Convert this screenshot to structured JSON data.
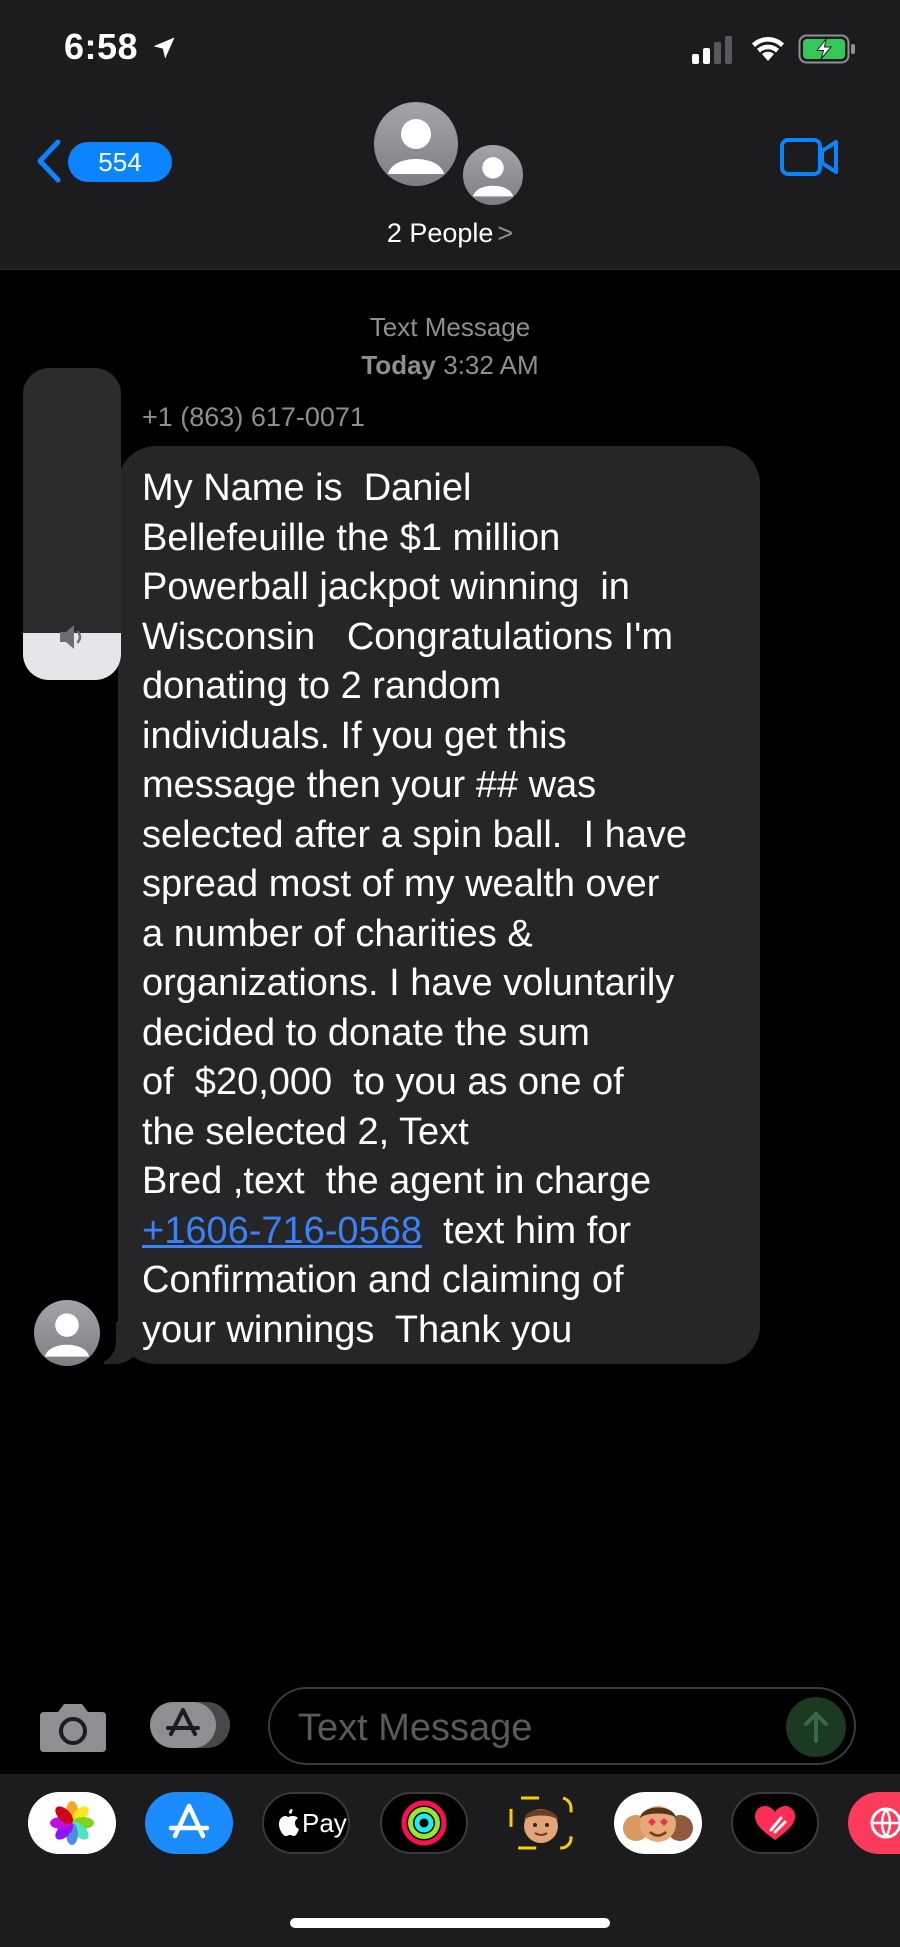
{
  "status_bar": {
    "time": "6:58",
    "icons": [
      "location-arrow-icon",
      "cellular-signal-icon",
      "wifi-icon",
      "battery-charging-icon"
    ]
  },
  "nav": {
    "back_badge_count": "554",
    "conversation_title": "2 People",
    "chevron": ">",
    "accent_color": "#0a84ff"
  },
  "thread": {
    "service_label": "Text Message",
    "date_day": "Today",
    "date_time": "3:32 AM",
    "sender": "+1 (863) 617-0071",
    "message": {
      "text_before_link": "My Name is  Daniel\nBellefeuille the $1 million\nPowerball jackpot winning  in\nWisconsin   Congratulations I'm\ndonating to 2 random\nindividuals. If you get this\nmessage then your ## was\nselected after a spin ball.  I have\nspread most of my wealth over\na number of charities &\norganizations. I have voluntarily\ndecided to donate the sum\nof  $20,000  to you as one of\nthe selected 2, Text\nBred ,text  the agent in charge\n",
      "link": "+1606-716-0568",
      "text_after_link": "  text him for\nConfirmation and claiming of\nyour winnings  Thank you",
      "link_color": "#3b82f6"
    }
  },
  "volume_hud": {
    "level": 0.15,
    "icon": "speaker-icon"
  },
  "composer": {
    "placeholder": "Text Message"
  },
  "app_drawer": {
    "apps": [
      {
        "name": "photos-app-icon"
      },
      {
        "name": "app-store-icon"
      },
      {
        "name": "apple-pay-icon",
        "label": "Pay"
      },
      {
        "name": "activity-icon"
      },
      {
        "name": "memoji-icon"
      },
      {
        "name": "memoji-stickers-icon"
      },
      {
        "name": "digital-touch-icon"
      },
      {
        "name": "web-search-icon"
      }
    ]
  }
}
